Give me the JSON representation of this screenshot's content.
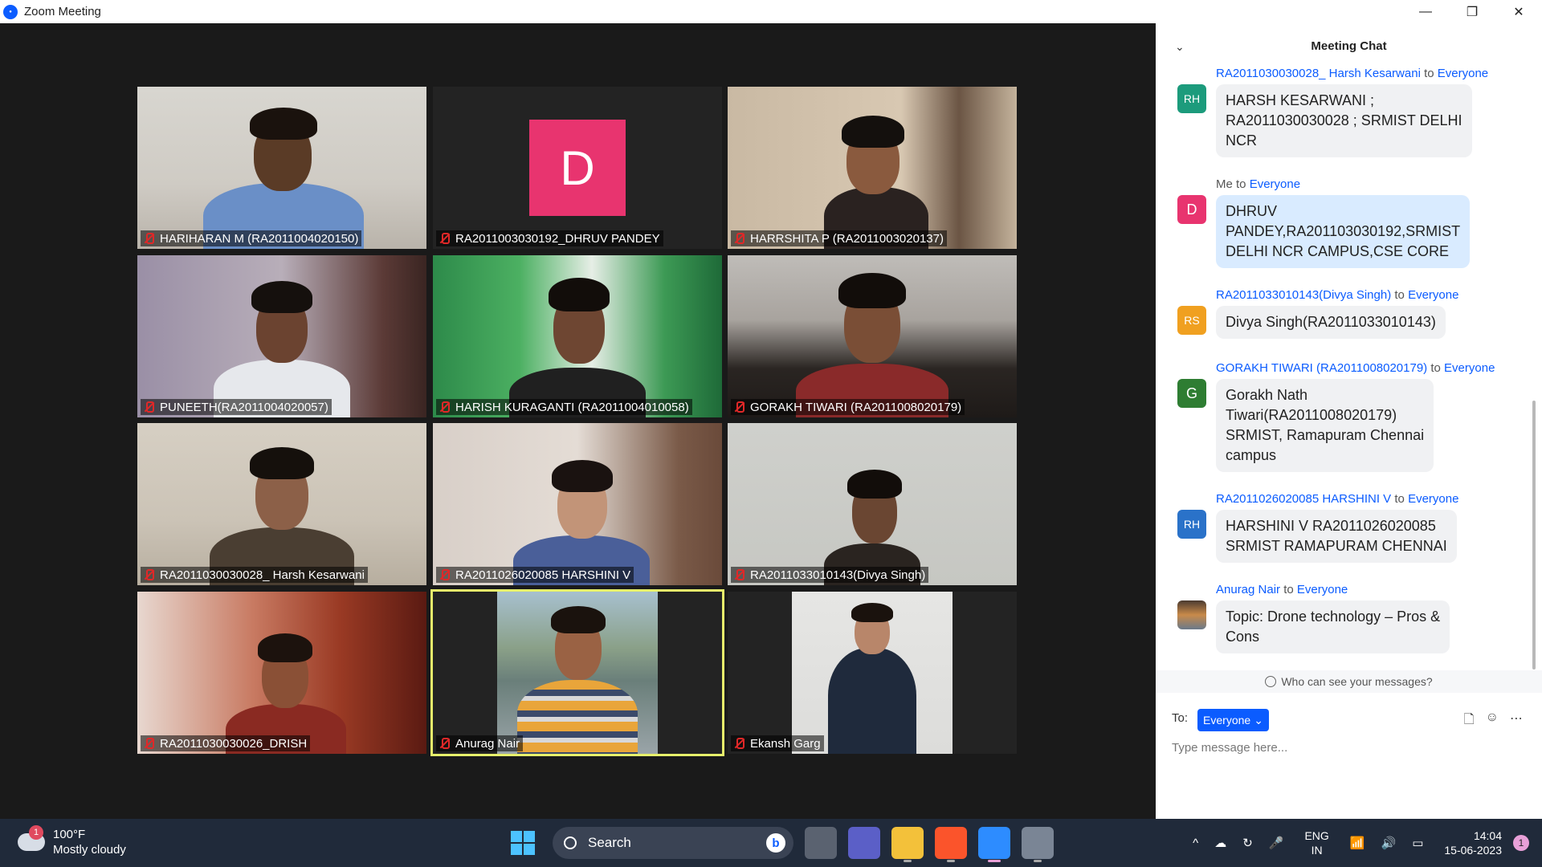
{
  "window": {
    "title": "Zoom Meeting",
    "minimize": "—",
    "restore": "❐",
    "close": "✕"
  },
  "participants": [
    {
      "name": "HARIHARAN M (RA2011004020150)"
    },
    {
      "name": "RA2011003030192_DHRUV PANDEY",
      "avatar_letter": "D"
    },
    {
      "name": "HARRSHITA P (RA2011003020137)"
    },
    {
      "name": "PUNEETH(RA2011004020057)"
    },
    {
      "name": "HARISH KURAGANTI (RA2011004010058)"
    },
    {
      "name": "GORAKH TIWARI (RA2011008020179)"
    },
    {
      "name": "RA2011030030028_ Harsh Kesarwani"
    },
    {
      "name": "RA2011026020085 HARSHINI V"
    },
    {
      "name": "RA2011033010143(Divya Singh)"
    },
    {
      "name": "RA2011030030026_DRISH"
    },
    {
      "name": "Anurag Nair"
    },
    {
      "name": "Ekansh Garg"
    }
  ],
  "chat": {
    "title": "Meeting Chat",
    "messages": [
      {
        "sender": "RA2011030030028_ Harsh Kesarwani",
        "to_word": "to",
        "to": "Everyone",
        "initials": "RH",
        "avatar_color": "#1c9b7c",
        "lines": [
          "HARSH KESARWANI ;",
          "RA2011030030028 ; SRMIST DELHI",
          "NCR"
        ]
      },
      {
        "sender": "Me",
        "to_word": "to",
        "to": "Everyone",
        "initials": "D",
        "avatar_color": "#e8346f",
        "lines": [
          "DHRUV",
          "PANDEY,RA201103030192,SRMIST",
          "DELHI NCR CAMPUS,CSE CORE"
        ]
      },
      {
        "sender": "RA2011033010143(Divya Singh)",
        "to_word": "to",
        "to": "Everyone",
        "initials": "RS",
        "avatar_color": "#f0a020",
        "lines": [
          "Divya Singh(RA2011033010143)"
        ]
      },
      {
        "sender": "GORAKH TIWARI (RA2011008020179)",
        "to_word": "to",
        "to": "Everyone",
        "initials": "G",
        "avatar_color": "#2e7d32",
        "lines": [
          "Gorakh Nath",
          "Tiwari(RA2011008020179)",
          "SRMIST, Ramapuram Chennai",
          "campus"
        ]
      },
      {
        "sender": "RA2011026020085 HARSHINI V",
        "to_word": "to",
        "to": "Everyone",
        "initials": "RH",
        "avatar_color": "#2a72c9",
        "lines": [
          "HARSHINI V RA2011026020085",
          "SRMIST RAMAPURAM CHENNAI"
        ]
      },
      {
        "sender": "Anurag Nair",
        "to_word": "to",
        "to": "Everyone",
        "initials": "",
        "avatar_color": "#c98a4a",
        "lines": [
          "Topic: Drone technology – Pros &",
          "Cons"
        ]
      }
    ],
    "privacy_note": "Who can see your messages?",
    "to_label": "To:",
    "to_value": "Everyone",
    "input_placeholder": "Type message here..."
  },
  "taskbar": {
    "weather_temp": "100°F",
    "weather_desc": "Mostly cloudy",
    "weather_badge": "1",
    "search_label": "Search",
    "lang_line1": "ENG",
    "lang_line2": "IN",
    "time": "14:04",
    "date": "15-06-2023",
    "notif_count": "1"
  }
}
